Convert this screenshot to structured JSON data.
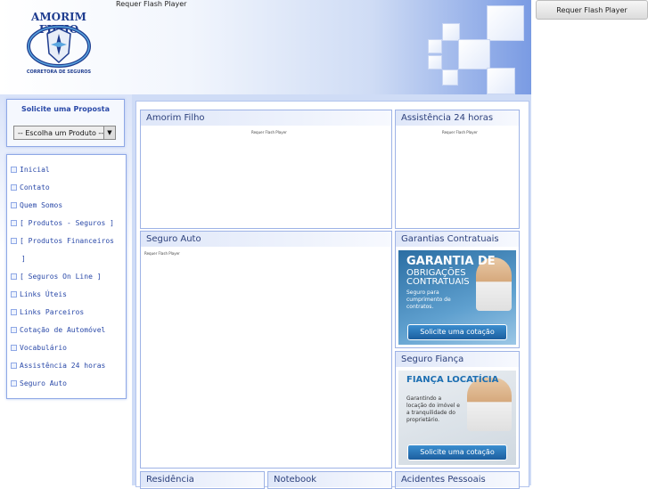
{
  "header": {
    "flash_notice": "Requer Flash Player",
    "logo_title": "AMORIM FILHO",
    "logo_subtitle": "CORRETORA DE SEGUROS"
  },
  "flash_button": {
    "label": "Requer Flash Player"
  },
  "proposta": {
    "title": "Solicite uma Proposta",
    "select_value": "-- Escolha um Produto --"
  },
  "menu": {
    "items": [
      "Inicial",
      "Contato",
      "Quem Somos",
      "[ Produtos - Seguros ]",
      "[ Produtos Financeiros",
      "]",
      "[ Seguros On Line ]",
      "Links Úteis",
      "Links Parceiros",
      "Cotação de Automóvel",
      "Vocabulário",
      "Assistência 24 horas",
      "Seguro Auto"
    ]
  },
  "panels": {
    "amorim": {
      "title": "Amorim Filho",
      "flash": "Requer Flash Player"
    },
    "assistencia": {
      "title": "Assistência 24 horas",
      "flash": "Requer Flash Player"
    },
    "seguro_auto": {
      "title": "Seguro Auto",
      "flash": "Requer Flash Player"
    },
    "garantias": {
      "title": "Garantias Contratuais",
      "banner_line1": "GARANTIA DE",
      "banner_line2": "OBRIGAÇÕES CONTRATUAIS",
      "banner_text": "Seguro para cumprimento de contratos.",
      "cta": "Solicite uma cotação"
    },
    "fianca": {
      "title": "Seguro Fiança",
      "banner_line1": "FIANÇA LOCATÍCIA",
      "banner_text": "Garantindo a locação do imóvel e a tranquilidade do proprietário.",
      "cta": "Solicite uma cotação"
    },
    "residencia": {
      "title": "Residência"
    },
    "notebook": {
      "title": "Notebook"
    },
    "acidentes": {
      "title": "Acidentes Pessoais"
    }
  }
}
